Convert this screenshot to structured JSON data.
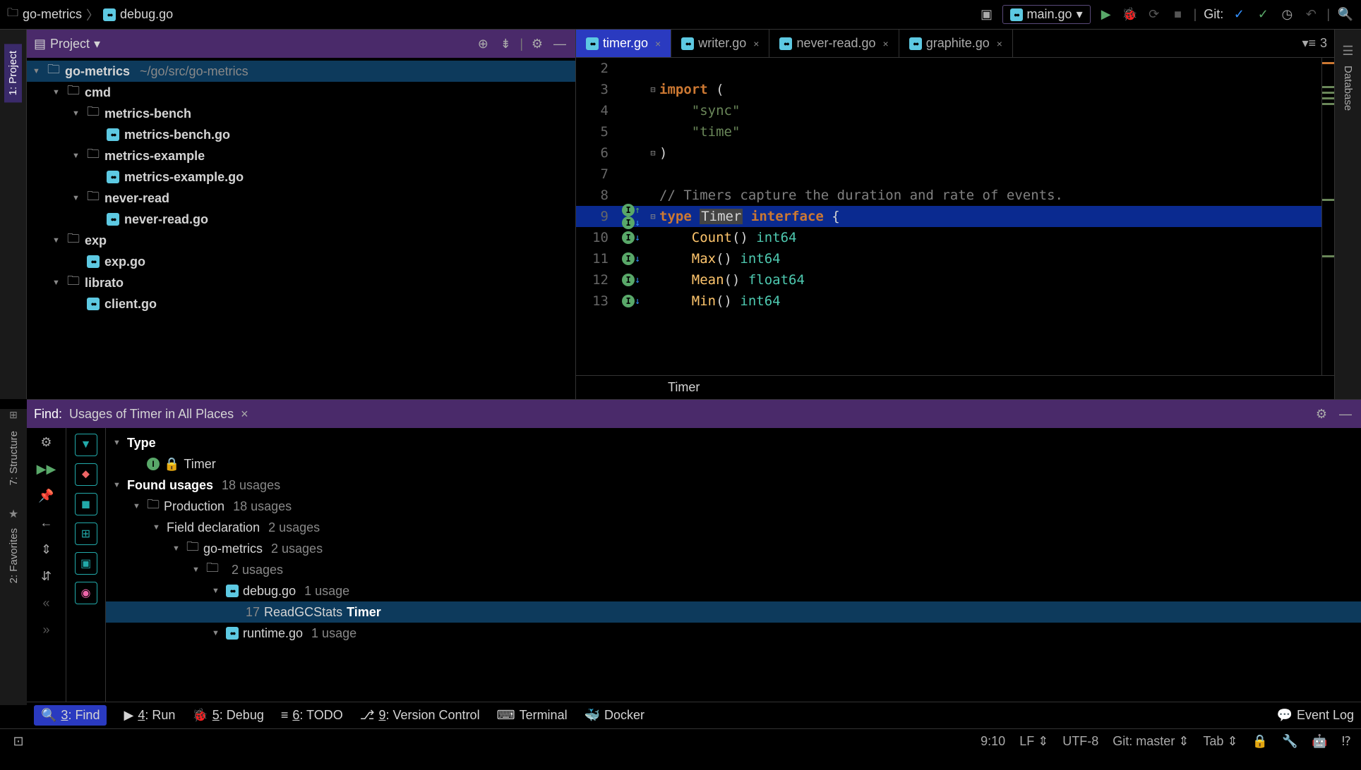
{
  "breadcrumb": {
    "root": "go-metrics",
    "file": "debug.go"
  },
  "toolbar": {
    "run_config": "main.go",
    "git_label": "Git:"
  },
  "left_tabs": [
    "1: Project",
    "7: Structure",
    "2: Favorites"
  ],
  "right_tabs": [
    "Database"
  ],
  "project_panel": {
    "title": "Project",
    "tree": [
      {
        "indent": 0,
        "arrow": "▼",
        "icon": "folder",
        "label": "go-metrics",
        "path": "~/go/src/go-metrics",
        "selected": true
      },
      {
        "indent": 1,
        "arrow": "▼",
        "icon": "folder",
        "label": "cmd"
      },
      {
        "indent": 2,
        "arrow": "▼",
        "icon": "folder",
        "label": "metrics-bench"
      },
      {
        "indent": 3,
        "arrow": "",
        "icon": "go",
        "label": "metrics-bench.go"
      },
      {
        "indent": 2,
        "arrow": "▼",
        "icon": "folder",
        "label": "metrics-example"
      },
      {
        "indent": 3,
        "arrow": "",
        "icon": "go",
        "label": "metrics-example.go"
      },
      {
        "indent": 2,
        "arrow": "▼",
        "icon": "folder",
        "label": "never-read"
      },
      {
        "indent": 3,
        "arrow": "",
        "icon": "go",
        "label": "never-read.go"
      },
      {
        "indent": 1,
        "arrow": "▼",
        "icon": "folder",
        "label": "exp"
      },
      {
        "indent": 2,
        "arrow": "",
        "icon": "go",
        "label": "exp.go"
      },
      {
        "indent": 1,
        "arrow": "▼",
        "icon": "folder",
        "label": "librato"
      },
      {
        "indent": 2,
        "arrow": "",
        "icon": "go",
        "label": "client.go"
      }
    ]
  },
  "editor": {
    "tabs": [
      {
        "name": "timer.go",
        "active": true
      },
      {
        "name": "writer.go",
        "active": false
      },
      {
        "name": "never-read.go",
        "active": false
      },
      {
        "name": "graphite.go",
        "active": false
      }
    ],
    "tabs_right_count": "3",
    "lines": [
      {
        "n": 2,
        "ann": "",
        "fold": "",
        "code": ""
      },
      {
        "n": 3,
        "ann": "",
        "fold": "⊟",
        "code": "<kw>import</kw> ("
      },
      {
        "n": 4,
        "ann": "",
        "fold": "",
        "code": "    <str>\"sync\"</str>"
      },
      {
        "n": 5,
        "ann": "",
        "fold": "",
        "code": "    <str>\"time\"</str>"
      },
      {
        "n": 6,
        "ann": "",
        "fold": "⊟",
        "code": ")"
      },
      {
        "n": 7,
        "ann": "",
        "fold": "",
        "code": ""
      },
      {
        "n": 8,
        "ann": "",
        "fold": "",
        "code": "<cmt>// Timers capture the duration and rate of events.</cmt>"
      },
      {
        "n": 9,
        "ann": "I↑ I↓",
        "fold": "⊟",
        "code": "<kw>type</kw> <sel>Timer</sel> <kw>interface</kw> {",
        "hl": true
      },
      {
        "n": 10,
        "ann": "I↓",
        "fold": "",
        "code": "    <typ>Count</typ>() <typ2>int64</typ2>"
      },
      {
        "n": 11,
        "ann": "I↓",
        "fold": "",
        "code": "    <typ>Max</typ>() <typ2>int64</typ2>"
      },
      {
        "n": 12,
        "ann": "I↓",
        "fold": "",
        "code": "    <typ>Mean</typ>() <typ2>float64</typ2>"
      },
      {
        "n": 13,
        "ann": "I↓",
        "fold": "",
        "code": "    <typ>Min</typ>() <typ2>int64</typ2>"
      }
    ],
    "status": "Timer"
  },
  "find": {
    "label": "Find:",
    "title": "Usages of Timer in All Places",
    "tree": [
      {
        "indent": 0,
        "arrow": "▼",
        "label": "Type",
        "bold": true
      },
      {
        "indent": 1,
        "arrow": "",
        "icon": "circle-i",
        "lock": true,
        "label": "Timer"
      },
      {
        "indent": 0,
        "arrow": "▼",
        "label": "Found usages",
        "count": "18 usages",
        "bold": true
      },
      {
        "indent": 1,
        "arrow": "▼",
        "icon": "folder-pkg",
        "label": "Production",
        "count": "18 usages"
      },
      {
        "indent": 2,
        "arrow": "▼",
        "label": "Field declaration",
        "count": "2 usages"
      },
      {
        "indent": 3,
        "arrow": "▼",
        "icon": "folder-pkg",
        "label": "go-metrics",
        "count": "2 usages"
      },
      {
        "indent": 4,
        "arrow": "▼",
        "icon": "folder",
        "label": "",
        "count": "2 usages"
      },
      {
        "indent": 5,
        "arrow": "▼",
        "icon": "go",
        "label": "debug.go",
        "count": "1 usage"
      },
      {
        "indent": 6,
        "arrow": "",
        "line": "17",
        "prefix": "ReadGCStats ",
        "match": "Timer",
        "sel": true
      },
      {
        "indent": 5,
        "arrow": "▼",
        "icon": "go",
        "label": "runtime.go",
        "count": "1 usage"
      }
    ]
  },
  "bottom_tools": [
    {
      "icon": "search",
      "label": "3: Find",
      "active": true,
      "ul": "3"
    },
    {
      "icon": "play",
      "label": "4: Run",
      "ul": "4"
    },
    {
      "icon": "bug",
      "label": "5: Debug",
      "ul": "5"
    },
    {
      "icon": "todo",
      "label": "6: TODO",
      "ul": "6"
    },
    {
      "icon": "vcs",
      "label": "9: Version Control",
      "ul": "9"
    },
    {
      "icon": "terminal",
      "label": "Terminal"
    },
    {
      "icon": "docker",
      "label": "Docker"
    }
  ],
  "bottom_right": "Event Log",
  "status": {
    "pos": "9:10",
    "line_sep": "LF",
    "encoding": "UTF-8",
    "git": "Git: master",
    "indent": "Tab"
  }
}
